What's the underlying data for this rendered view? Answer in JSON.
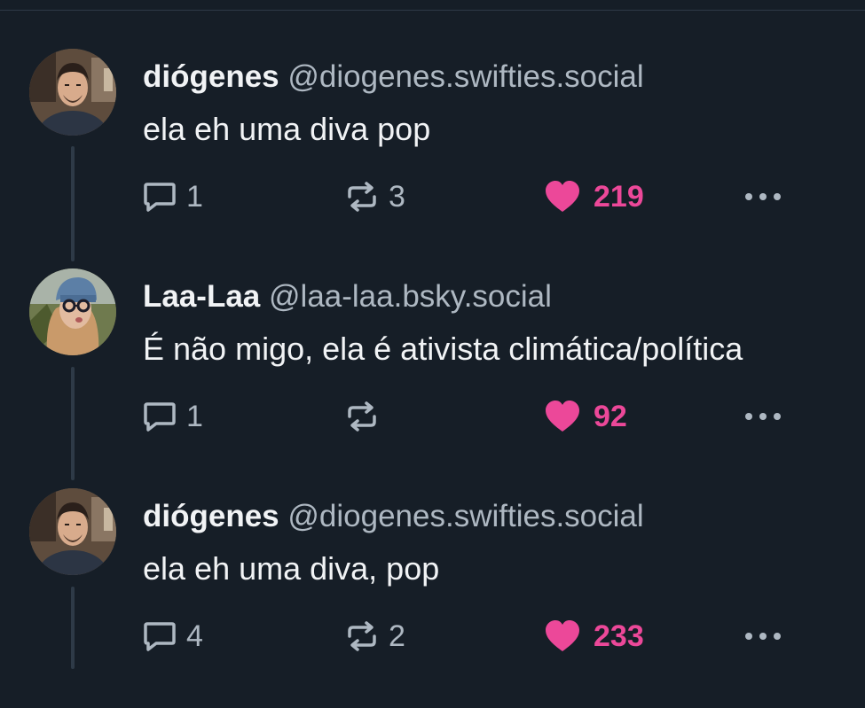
{
  "colors": {
    "background": "#161e27",
    "text": "#f1f3f5",
    "muted": "#aeb8c2",
    "like": "#ec4899",
    "thread_line": "#2e3a47"
  },
  "posts": [
    {
      "display_name": "diógenes",
      "handle": "@diogenes.swifties.social",
      "text": "ela eh uma diva pop",
      "replies": "1",
      "reposts": "3",
      "likes": "219",
      "liked": true,
      "avatar_icon": "user-avatar-man"
    },
    {
      "display_name": "Laa-Laa",
      "handle": "@laa-laa.bsky.social",
      "text": "É não migo, ela é ativista climática/política",
      "replies": "1",
      "reposts": "",
      "likes": "92",
      "liked": true,
      "avatar_icon": "user-avatar-woman"
    },
    {
      "display_name": "diógenes",
      "handle": "@diogenes.swifties.social",
      "text": "ela eh uma diva, pop",
      "replies": "4",
      "reposts": "2",
      "likes": "233",
      "liked": true,
      "avatar_icon": "user-avatar-man"
    }
  ]
}
